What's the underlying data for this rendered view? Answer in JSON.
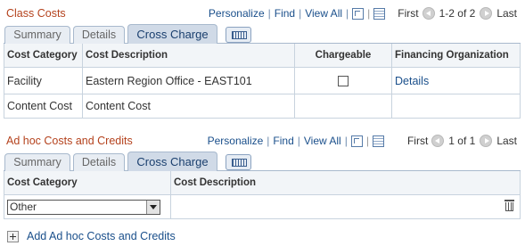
{
  "class_costs": {
    "title": "Class Costs",
    "nav": {
      "personalize": "Personalize",
      "find": "Find",
      "view_all": "View All",
      "first": "First",
      "range": "1-2 of 2",
      "last": "Last"
    },
    "icons": {
      "zoom": "zoom-icon",
      "download": "download-icon",
      "prev": "prev-arrow-icon",
      "next": "next-arrow-icon",
      "tab_grid": "show-all-columns-icon"
    },
    "tabs": [
      {
        "label": "Summary",
        "active": false
      },
      {
        "label": "Details",
        "active": false
      },
      {
        "label": "Cross Charge",
        "active": true
      }
    ],
    "columns": [
      "Cost Category",
      "Cost Description",
      "Chargeable",
      "Financing Organization"
    ],
    "rows": [
      {
        "category": "Facility",
        "description": "Eastern Region Office - EAST101",
        "chargeable": false,
        "financing": "Details"
      },
      {
        "category": "Content Cost",
        "description": "Content Cost",
        "chargeable": null,
        "financing": ""
      }
    ]
  },
  "adhoc": {
    "title": "Ad hoc Costs and Credits",
    "nav": {
      "personalize": "Personalize",
      "find": "Find",
      "view_all": "View All",
      "first": "First",
      "range": "1 of 1",
      "last": "Last"
    },
    "tabs": [
      {
        "label": "Summary",
        "active": false
      },
      {
        "label": "Details",
        "active": false
      },
      {
        "label": "Cross Charge",
        "active": true
      }
    ],
    "columns": [
      "Cost Category",
      "Cost Description"
    ],
    "rows": [
      {
        "category_value": "Other",
        "description": ""
      }
    ],
    "delete_icon": "trash-icon"
  },
  "add_link": {
    "label": "Add Ad hoc Costs and Credits",
    "icon": "plus-icon"
  },
  "colors": {
    "title": "#b4421d",
    "link": "#1a4f8b",
    "tab_active_bg": "#d0dae7",
    "border": "#c8d3de"
  }
}
